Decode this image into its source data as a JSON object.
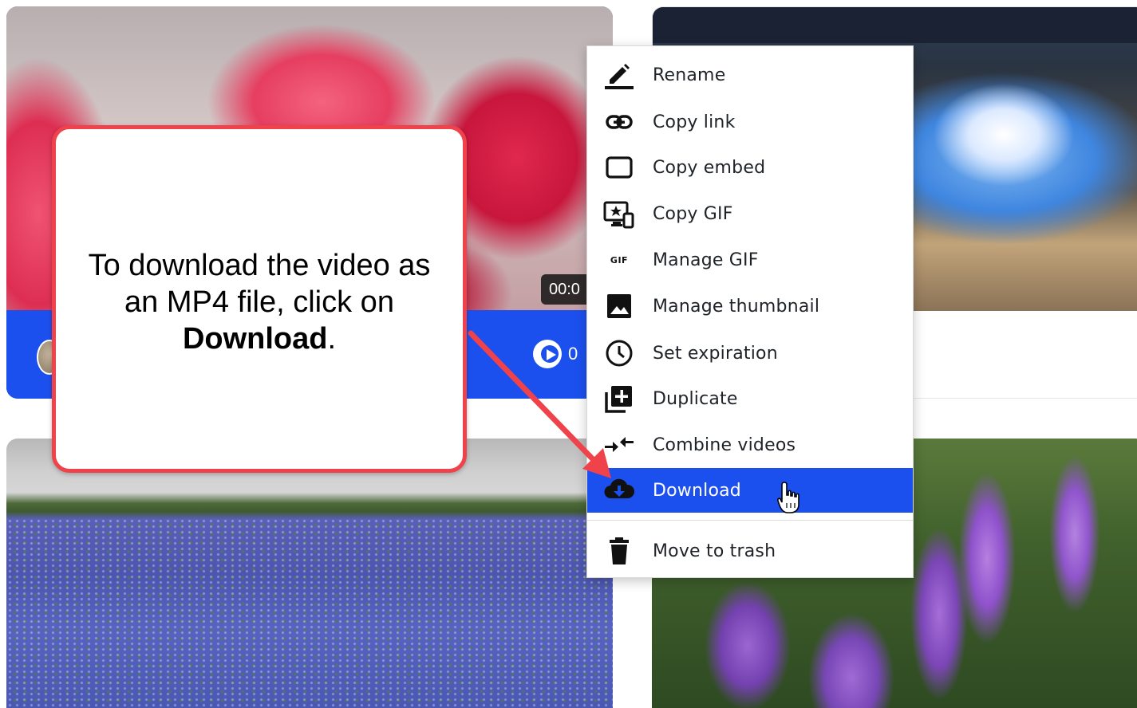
{
  "cards": {
    "tulip": {
      "duration": "00:0",
      "views": "0"
    }
  },
  "callout": {
    "line1": "To download the video as",
    "line2": "an MP4 file, click on",
    "emphasis": "Download",
    "suffix": "."
  },
  "menu": {
    "items": [
      {
        "label": "Rename",
        "icon": "pencil-icon"
      },
      {
        "label": "Copy link",
        "icon": "link-icon"
      },
      {
        "label": "Copy embed",
        "icon": "embed-icon"
      },
      {
        "label": "Copy GIF",
        "icon": "gif-screen-icon"
      },
      {
        "label": "Manage GIF",
        "icon": "gif-icon"
      },
      {
        "label": "Manage thumbnail",
        "icon": "image-icon"
      },
      {
        "label": "Set expiration",
        "icon": "clock-icon"
      },
      {
        "label": "Duplicate",
        "icon": "duplicate-icon"
      },
      {
        "label": "Combine videos",
        "icon": "combine-icon"
      },
      {
        "label": "Download",
        "icon": "cloud-download-icon",
        "active": true
      },
      {
        "label": "Move to trash",
        "icon": "trash-icon"
      }
    ],
    "gif_badge": "GIF"
  },
  "colors": {
    "accent": "#1c50ee",
    "callout_border": "#f0424a",
    "arrow": "#f0424a"
  }
}
